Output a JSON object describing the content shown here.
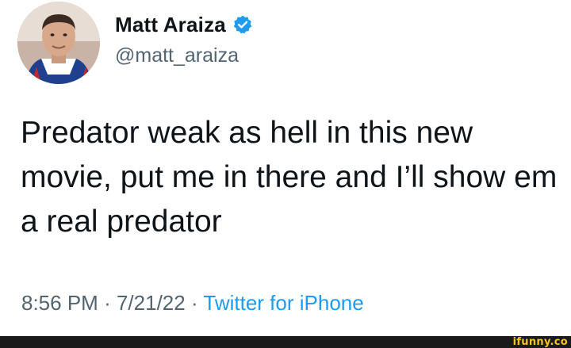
{
  "tweet": {
    "display_name": "Matt Araiza",
    "verified": true,
    "handle": "@matt_araiza",
    "text": "Predator weak as hell in this new movie, put me in there and I’ll show em a real predator",
    "time": "8:56 PM",
    "separator": "·",
    "date": "7/21/22",
    "source": "Twitter for iPhone",
    "avatar_icon": "profile-photo",
    "verified_icon": "verified-badge-icon"
  },
  "watermark": {
    "text": "ifunny.co"
  },
  "colors": {
    "verified_blue": "#1d9bf0",
    "text": "#0f1419",
    "secondary_text": "#536471",
    "footer": "#1a1a1a",
    "watermark": "#f5c518"
  }
}
